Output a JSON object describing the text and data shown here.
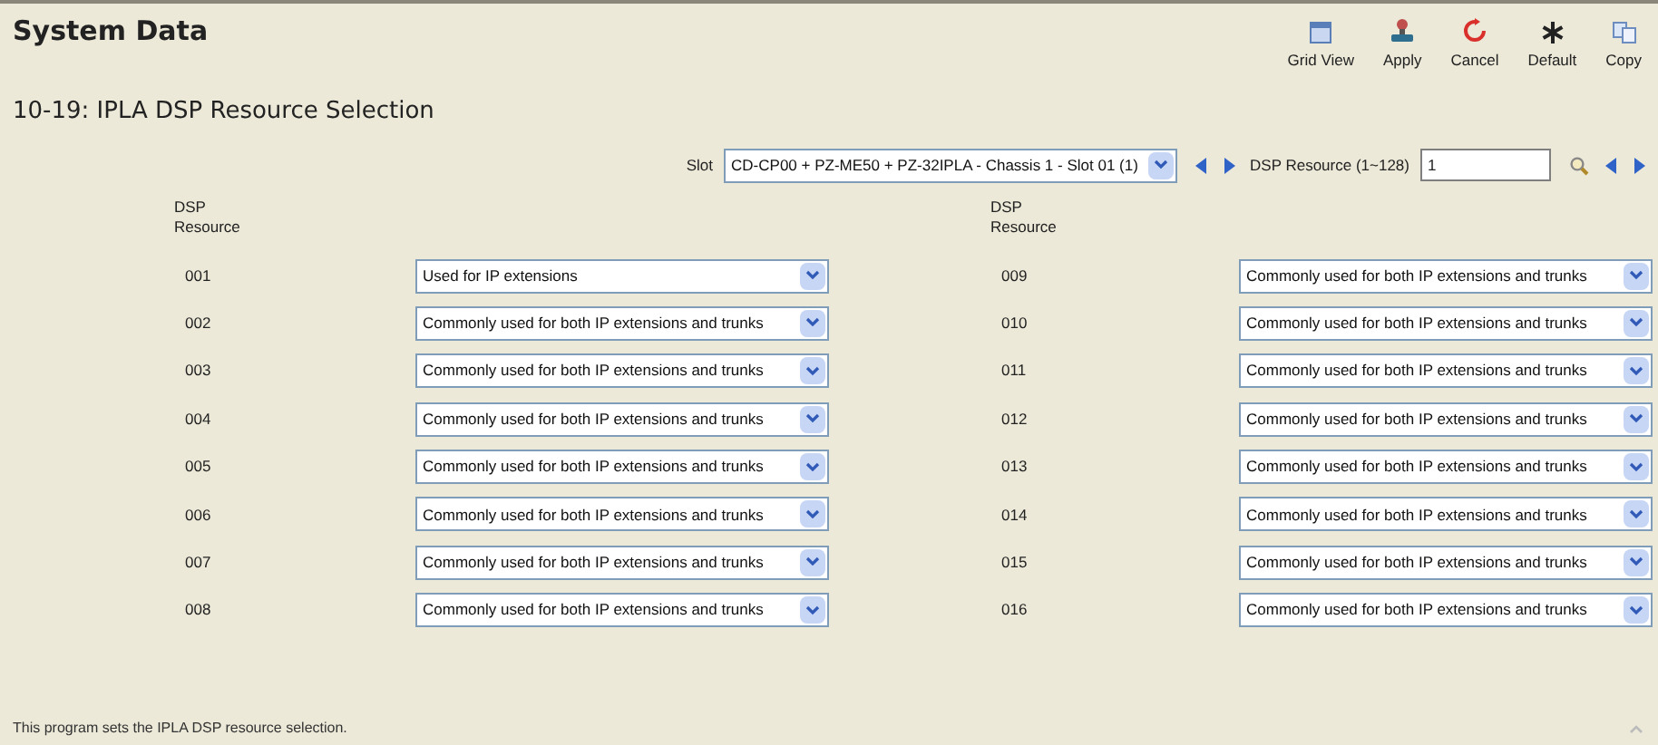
{
  "window": {
    "title": "System Data"
  },
  "toolbar": [
    {
      "kind": "grid",
      "label": "Grid View"
    },
    {
      "kind": "apply",
      "label": "Apply"
    },
    {
      "kind": "cancel",
      "label": "Cancel"
    },
    {
      "kind": "default",
      "label": "Default"
    },
    {
      "kind": "copy",
      "label": "Copy"
    }
  ],
  "page_title": "10-19: IPLA DSP Resource Selection",
  "slot": {
    "label": "Slot",
    "value": "CD-CP00 + PZ-ME50 + PZ-32IPLA - Chassis 1 - Slot 01 (1)"
  },
  "dsp_search": {
    "label": "DSP Resource (1~128)",
    "value": "1"
  },
  "columns": [
    {
      "header": "DSP Resource",
      "rows": [
        {
          "resource": "001",
          "value": "Used for IP extensions"
        },
        {
          "resource": "002",
          "value": "Commonly used for both IP extensions and trunks"
        },
        {
          "resource": "003",
          "value": "Commonly used for both IP extensions and trunks"
        },
        {
          "resource": "004",
          "value": "Commonly used for both IP extensions and trunks"
        },
        {
          "resource": "005",
          "value": "Commonly used for both IP extensions and trunks"
        },
        {
          "resource": "006",
          "value": "Commonly used for both IP extensions and trunks"
        },
        {
          "resource": "007",
          "value": "Commonly used for both IP extensions and trunks"
        },
        {
          "resource": "008",
          "value": "Commonly used for both IP extensions and trunks"
        }
      ]
    },
    {
      "header": "DSP Resource",
      "rows": [
        {
          "resource": "009",
          "value": "Commonly used for both IP extensions and trunks"
        },
        {
          "resource": "010",
          "value": "Commonly used for both IP extensions and trunks"
        },
        {
          "resource": "011",
          "value": "Commonly used for both IP extensions and trunks"
        },
        {
          "resource": "012",
          "value": "Commonly used for both IP extensions and trunks"
        },
        {
          "resource": "013",
          "value": "Commonly used for both IP extensions and trunks"
        },
        {
          "resource": "014",
          "value": "Commonly used for both IP extensions and trunks"
        },
        {
          "resource": "015",
          "value": "Commonly used for both IP extensions and trunks"
        },
        {
          "resource": "016",
          "value": "Commonly used for both IP extensions and trunks"
        }
      ]
    }
  ],
  "status_bar": "This program sets the IPLA DSP resource selection."
}
